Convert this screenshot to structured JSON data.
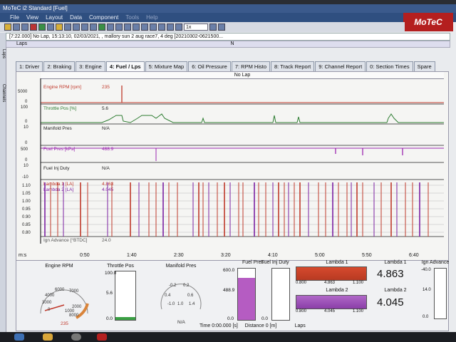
{
  "window": {
    "title": "MoTeC i2 Standard [Fuel]",
    "brand": "MoTeC",
    "menu": [
      "File",
      "View",
      "Layout",
      "Data",
      "Component",
      "Tools",
      "Help"
    ]
  },
  "info": {
    "line": "[7:22.000] No Lap, 15:13:10, 02/03/2021, , mallory sun 2 aug race7, 4 deg [20210302-0621500...",
    "laps_label": "Laps",
    "zoom": "1x",
    "marker": "N"
  },
  "side_tabs": [
    "Laps",
    "Channels"
  ],
  "tabs": [
    {
      "label": "1: Driver",
      "active": false
    },
    {
      "label": "2: Braking",
      "active": false
    },
    {
      "label": "3: Engine",
      "active": false
    },
    {
      "label": "4: Fuel / Lps",
      "active": true
    },
    {
      "label": "5: Mixture Map",
      "active": false
    },
    {
      "label": "6: Oil Pressure",
      "active": false
    },
    {
      "label": "7: RPM Histo",
      "active": false
    },
    {
      "label": "8: Track Report",
      "active": false
    },
    {
      "label": "9: Channel Report",
      "active": false
    },
    {
      "label": "0: Section Times",
      "active": false
    },
    {
      "label": "Spare",
      "active": false
    }
  ],
  "plot": {
    "header": "No Lap",
    "channels": [
      {
        "name": "Engine RPM [rpm]",
        "value": "235",
        "color": "#c0392b",
        "ymax": "5000",
        "ymin": "0"
      },
      {
        "name": "Throttle Pos [%]",
        "value": "5.6",
        "color": "#2e7d32",
        "ymax": "100",
        "ymin": "0"
      },
      {
        "name": "Manifold Pres",
        "value": "N/A",
        "color": "#333333",
        "ymax": "10",
        "ymin": "0"
      },
      {
        "name": "Fuel Pres [kPa]",
        "value": "488.9",
        "color": "#9c27b0",
        "ymax": "500",
        "ymin": "0"
      },
      {
        "name": "Fuel Inj Duty",
        "value": "N/A",
        "color": "#333333",
        "ymax": "10",
        "ymin": "-10"
      },
      {
        "name": "Lambda 1 [LA]",
        "value": "4.863",
        "color": "#c0392b"
      },
      {
        "name": "Lambda 2 [LA]",
        "value": "4.045",
        "color": "#7b1fa2"
      },
      {
        "name": "Ign Advance [°BTDC]",
        "value": "24.0",
        "color": "#555555"
      }
    ],
    "lambda_ticks": [
      "1.10",
      "1.05",
      "1.00",
      "0.95",
      "0.90",
      "0.85",
      "0.80"
    ],
    "x_unit": "m:s",
    "x_ticks": [
      "0:50",
      "1:40",
      "2:30",
      "3:20",
      "4:10",
      "5:00",
      "5:50",
      "6:40"
    ]
  },
  "gauges": {
    "rpm": {
      "title": "Engine RPM",
      "value": "235",
      "ticks": [
        "0",
        "2000",
        "4000",
        "6000",
        "8000",
        "3000",
        "1000",
        "7000"
      ]
    },
    "throttle": {
      "title": "Throttle Pos",
      "max": "100.0",
      "value": "5.6",
      "min": "0.0",
      "fraction": 0.056
    },
    "manifold": {
      "title": "Manifold Pres",
      "ticks": [
        "-0.2",
        "0.2",
        "0.4",
        "0.6",
        "1.0",
        "1.4",
        "-1.0"
      ],
      "value": "N/A"
    },
    "fuelpres": {
      "title": "Fuel Pres",
      "max": "600.0",
      "value": "488.9",
      "min": "0.0",
      "fraction": 0.815
    },
    "injduty": {
      "title": "Fuel Inj Duty",
      "max": "",
      "value": "",
      "min": "0.0"
    },
    "lambda1": {
      "title": "Lambda 1",
      "min": "0.800",
      "value": "4.863",
      "max": "1.100"
    },
    "lambda2": {
      "title": "Lambda 2",
      "min": "0.800",
      "value": "4.045",
      "max": "1.100"
    },
    "lambda1_big": {
      "title": "Lambda 1",
      "value": "4.863"
    },
    "lambda2_big": {
      "title": "Lambda 2",
      "value": "4.045"
    },
    "ign": {
      "title": "Ign Advance",
      "max": "-40.0",
      "value": "14.0",
      "min": "0.0"
    }
  },
  "status": {
    "time_label": "Time",
    "time_value": "0:00.000 [s]",
    "distance_label": "Distance",
    "distance_value": "0 [m]",
    "laps_label": "Laps"
  },
  "colors": {
    "accent": "#b41f1f",
    "rpm": "#c0392b",
    "throttle": "#2e7d32",
    "fuel": "#9c27b0",
    "lambda1": "#c0392b",
    "lambda2": "#7b1fa2"
  }
}
